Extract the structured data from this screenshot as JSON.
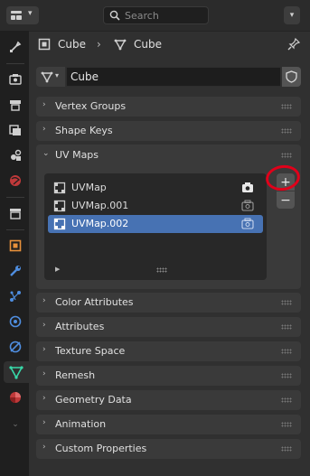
{
  "search": {
    "placeholder": "Search"
  },
  "breadcrumb": {
    "object_name": "Cube",
    "data_name": "Cube"
  },
  "datablock": {
    "name": "Cube"
  },
  "panels_top": [
    {
      "title": "Vertex Groups"
    },
    {
      "title": "Shape Keys"
    }
  ],
  "uv_maps": {
    "title": "UV Maps",
    "items": [
      {
        "name": "UVMap",
        "render_active": true,
        "selected": false
      },
      {
        "name": "UVMap.001",
        "render_active": false,
        "selected": false
      },
      {
        "name": "UVMap.002",
        "render_active": false,
        "selected": true
      }
    ],
    "add_label": "+",
    "remove_label": "−"
  },
  "panels_bottom": [
    {
      "title": "Color Attributes"
    },
    {
      "title": "Attributes"
    },
    {
      "title": "Texture Space"
    },
    {
      "title": "Remesh"
    },
    {
      "title": "Geometry Data"
    },
    {
      "title": "Animation"
    },
    {
      "title": "Custom Properties"
    }
  ],
  "colors": {
    "accent_selected": "#4772b3",
    "annotation_circle": "#e0001a",
    "data_tab_icon": "#38d9a9"
  }
}
